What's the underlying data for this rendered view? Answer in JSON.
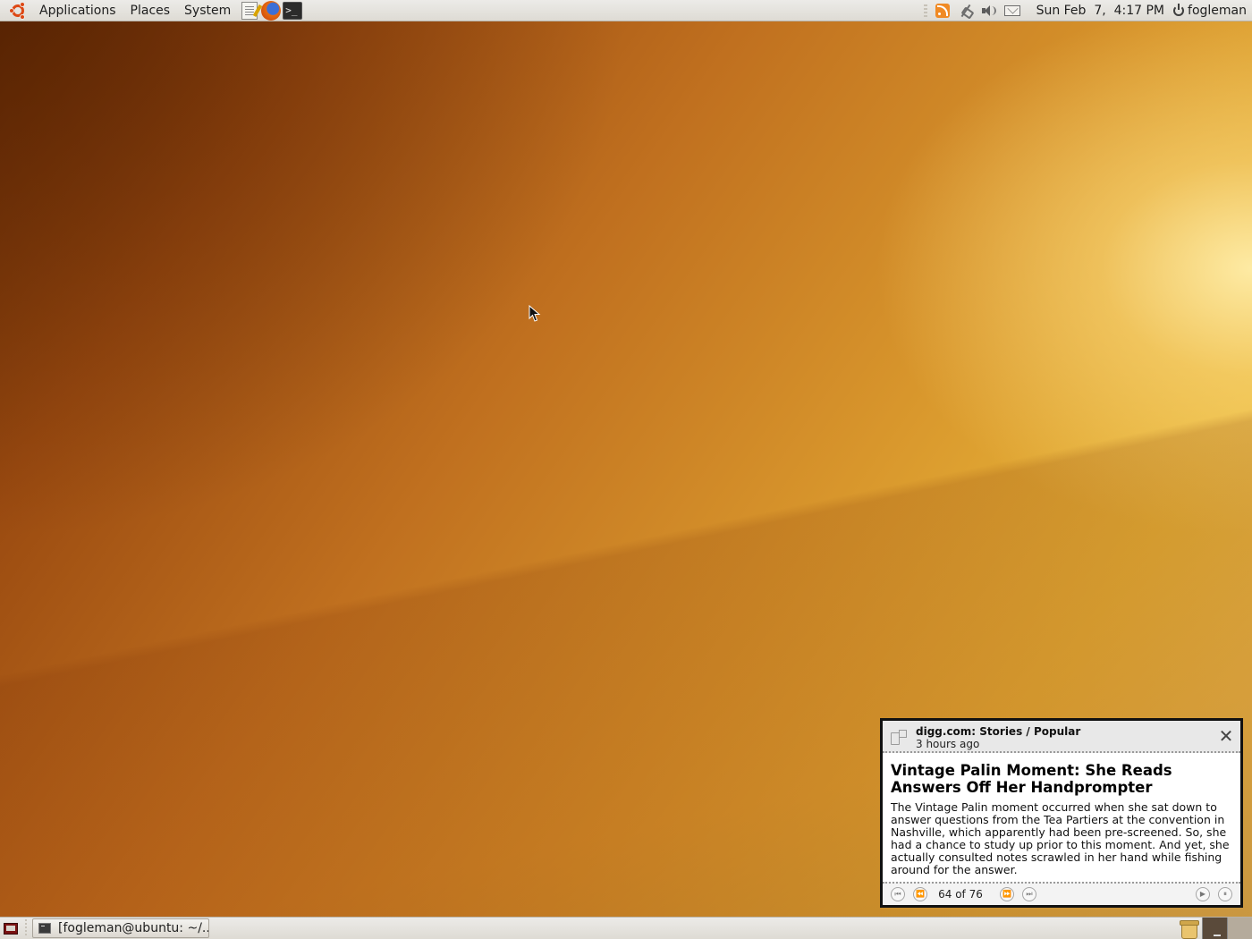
{
  "top_panel": {
    "menus": [
      "Applications",
      "Places",
      "System"
    ],
    "launchers": [
      {
        "name": "text-editor-launcher",
        "icon": "text-editor-icon"
      },
      {
        "name": "firefox-launcher",
        "icon": "firefox-icon"
      },
      {
        "name": "terminal-launcher",
        "icon": "terminal-icon",
        "glyph": ">_"
      }
    ],
    "tray_icons": [
      "rss-feed-icon",
      "network-icon",
      "volume-icon",
      "mail-icon"
    ],
    "clock": "Sun Feb  7,  4:17 PM",
    "user": "fogleman"
  },
  "bottom_panel": {
    "show_desktop_icon": "show-desktop-icon",
    "tasks": [
      {
        "label": "[fogleman@ubuntu: ~/...",
        "icon": "terminal-icon"
      }
    ],
    "trash_icon": "trash-icon",
    "workspaces": 2,
    "active_workspace": 1
  },
  "notification": {
    "source": "digg.com: Stories / Popular",
    "time": "3 hours ago",
    "title": "Vintage Palin Moment: She Reads Answers Off Her Handprompter",
    "body": "The Vintage Palin moment occurred when she sat down to answer questions from the Tea Partiers at the convention in Nashville, which apparently had been pre-screened. So, she had a chance to study up prior to this moment. And yet, she actually consulted notes scrawled in her hand while fishing around for the answer.",
    "counter": "64 of 76",
    "close_glyph": "✕",
    "nav": {
      "first": "⏮",
      "previous": "⏪",
      "next": "⏩",
      "last": "⏭",
      "play": "▶",
      "pause": "⏸"
    }
  },
  "colors": {
    "panel": "#dedbd4",
    "ubuntu_orange": "#dd4814",
    "wallpaper_dark": "#6b2e05",
    "wallpaper_light": "#f3cf5f"
  }
}
